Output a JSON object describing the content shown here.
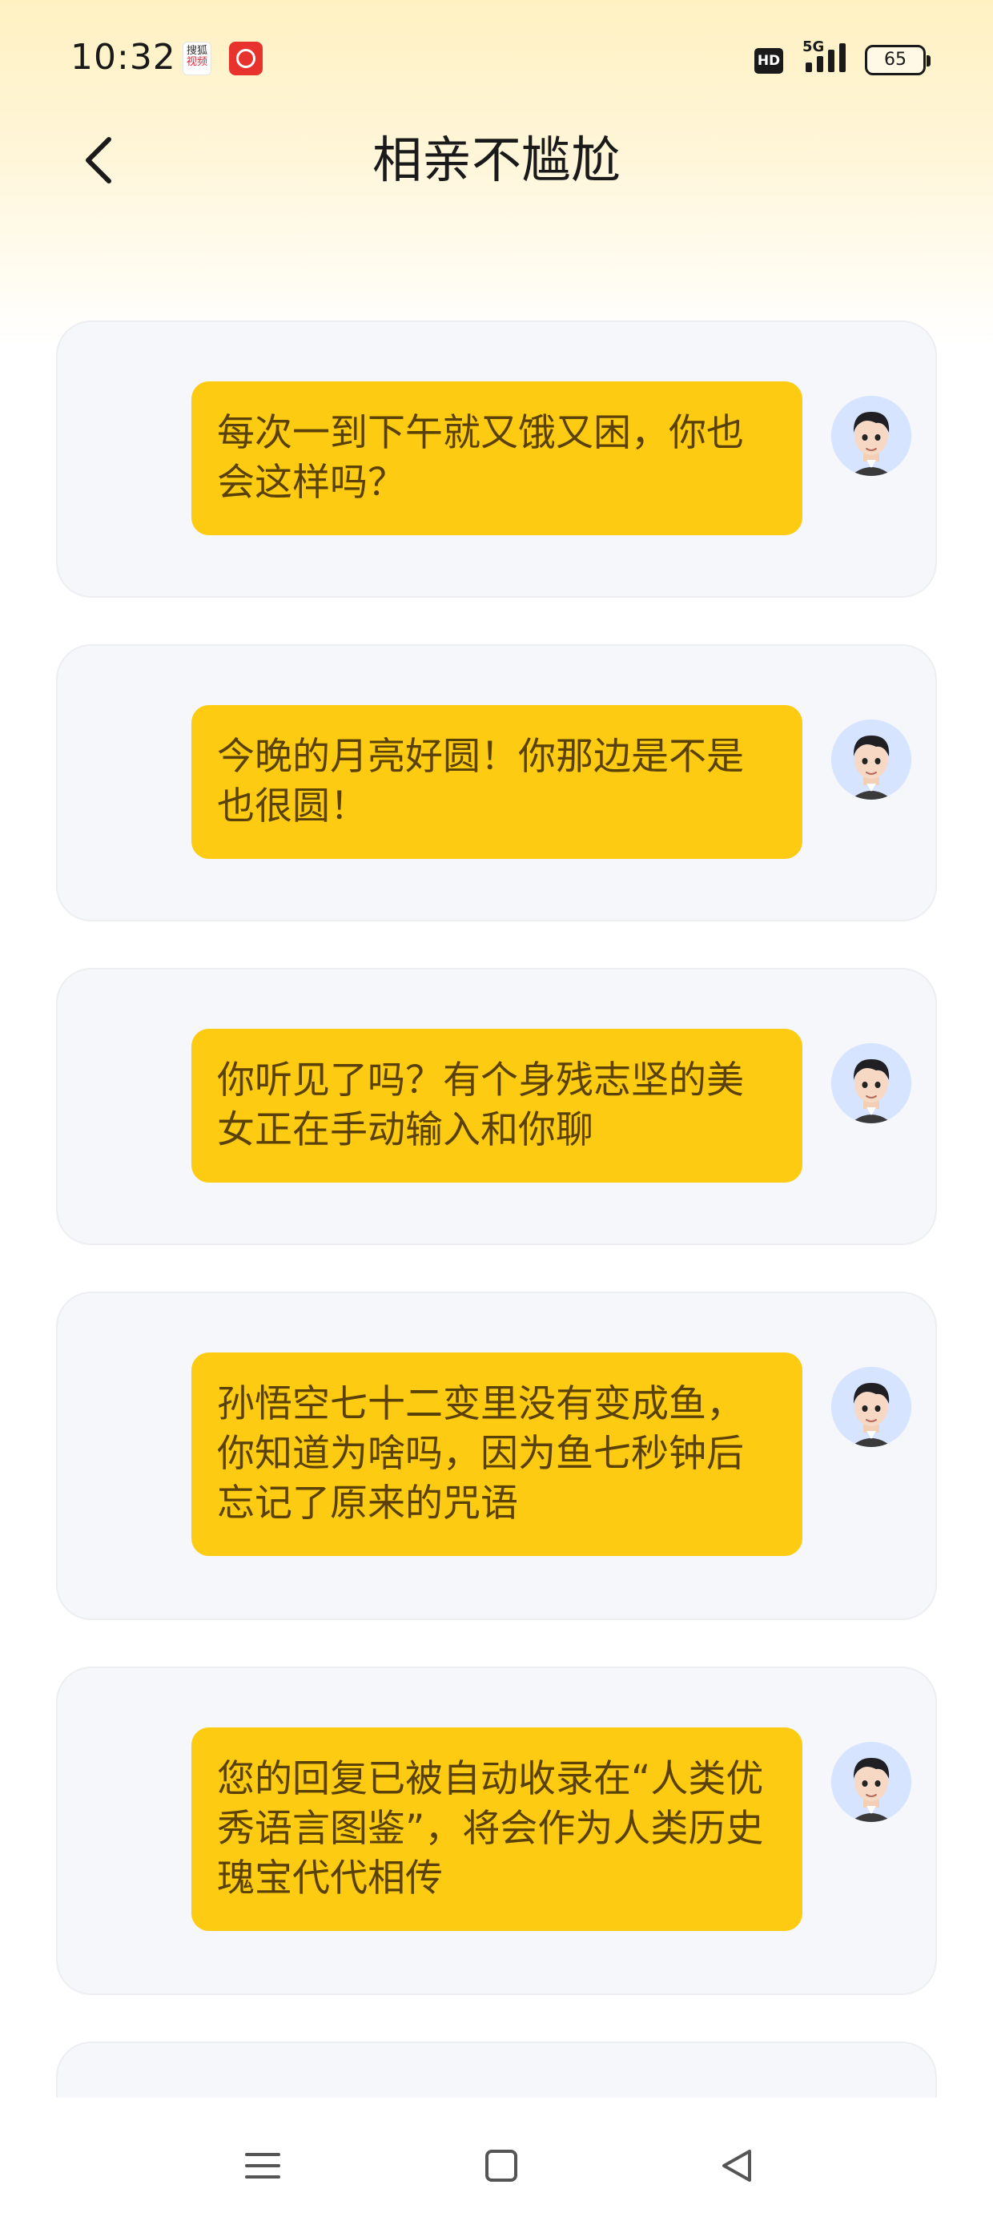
{
  "status_bar": {
    "time": "10:32",
    "app_icons": [
      "sohu-video-icon",
      "netease-music-icon"
    ],
    "sohu_label_top": "搜狐",
    "sohu_label_bottom": "视频",
    "hd": "HD",
    "network": "5G",
    "battery": "65"
  },
  "header": {
    "title": "相亲不尴尬",
    "back_icon": "chevron-left-icon"
  },
  "messages": [
    {
      "text": "每次一到下午就又饿又困，你也会这样吗？"
    },
    {
      "text": "今晚的月亮好圆！你那边是不是也很圆！"
    },
    {
      "text": "你听见了吗？有个身残志坚的美女正在手动输入和你聊"
    },
    {
      "text": "孙悟空七十二变里没有变成鱼，你知道为啥吗，因为鱼七秒钟后忘记了原来的咒语"
    },
    {
      "text": "您的回复已被自动收录在“人类优秀语言图鉴”，将会作为人类历史瑰宝代代相传"
    }
  ],
  "nav": {
    "menu_icon": "menu-icon",
    "home_icon": "home-square-icon",
    "back_icon": "back-triangle-icon"
  },
  "colors": {
    "bubble": "#fdcc12",
    "bubble_text": "#5a4108",
    "card_bg": "#f5f7fa",
    "header_gradient": "#fff1c2"
  }
}
